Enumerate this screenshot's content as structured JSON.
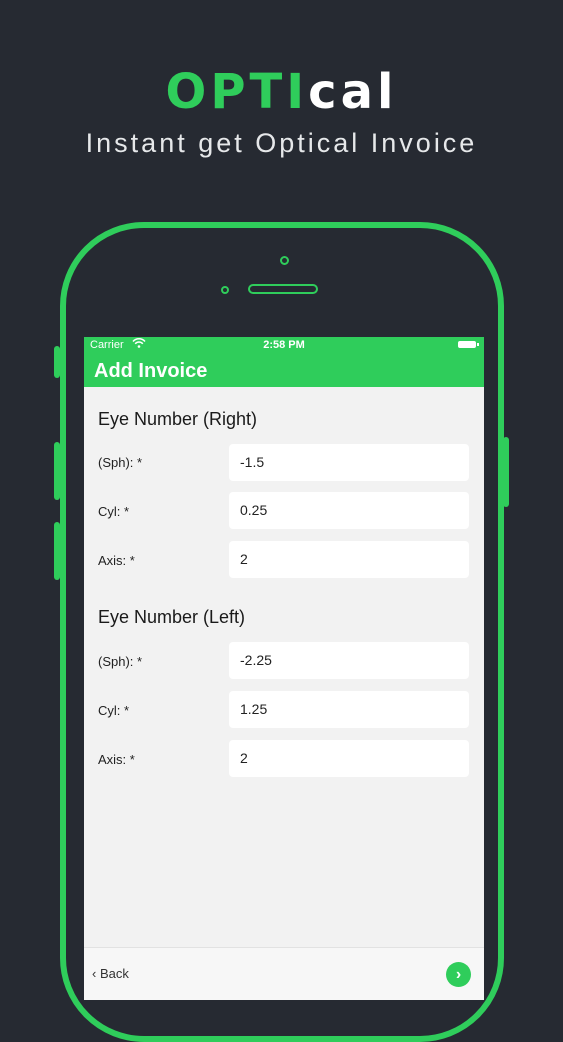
{
  "brand": {
    "part1": "OPTI",
    "part2": "cal"
  },
  "tagline": "Instant get Optical Invoice",
  "status_bar": {
    "carrier": "Carrier",
    "time": "2:58 PM"
  },
  "screen": {
    "title": "Add Invoice"
  },
  "right_eye": {
    "title": "Eye Number (Right)",
    "fields": [
      {
        "label": "(Sph): *",
        "value": "-1.5"
      },
      {
        "label": "Cyl: *",
        "value": "0.25"
      },
      {
        "label": "Axis: *",
        "value": "2"
      }
    ]
  },
  "left_eye": {
    "title": "Eye Number (Left)",
    "fields": [
      {
        "label": "(Sph): *",
        "value": "-2.25"
      },
      {
        "label": "Cyl: *",
        "value": "1.25"
      },
      {
        "label": "Axis: *",
        "value": "2"
      }
    ]
  },
  "footer": {
    "back_label": "Back"
  },
  "colors": {
    "accent": "#2fcd5b",
    "background": "#262a32",
    "screen": "#f2f2f2"
  }
}
